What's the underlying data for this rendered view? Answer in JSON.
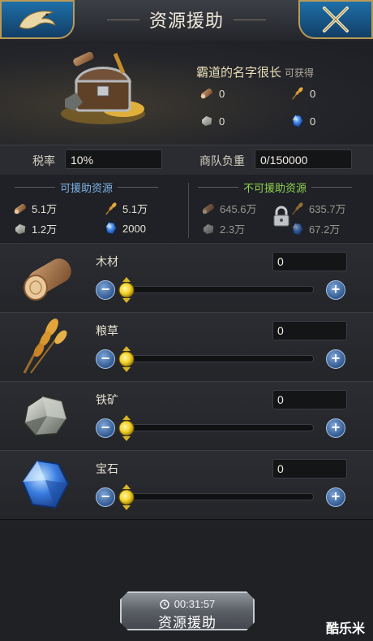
{
  "header": {
    "title": "资源援助",
    "back_icon": "dragon-back-icon",
    "close_icon": "crossed-swords-close-icon"
  },
  "receiver": {
    "name": "霸道的名字很长",
    "suffix": "可获得",
    "gains": [
      {
        "icon": "wood-icon",
        "value": "0"
      },
      {
        "icon": "wheat-icon",
        "value": "0"
      },
      {
        "icon": "iron-ore-icon",
        "value": "0"
      },
      {
        "icon": "gem-icon",
        "value": "0"
      }
    ]
  },
  "tax": {
    "label": "税率",
    "value": "10%"
  },
  "caravan": {
    "label": "商队负重",
    "value": "0/150000"
  },
  "available": {
    "title": "可援助资源",
    "items": [
      {
        "icon": "wood-icon",
        "value": "5.1万"
      },
      {
        "icon": "wheat-icon",
        "value": "5.1万"
      },
      {
        "icon": "iron-ore-icon",
        "value": "1.2万"
      },
      {
        "icon": "gem-icon",
        "value": "2000"
      }
    ]
  },
  "unavailable": {
    "title": "不可援助资源",
    "items": [
      {
        "icon": "wood-icon",
        "value": "645.6万"
      },
      {
        "icon": "wheat-icon",
        "value": "635.7万"
      },
      {
        "icon": "iron-ore-icon",
        "value": "2.3万"
      },
      {
        "icon": "gem-icon",
        "value": "67.2万"
      }
    ]
  },
  "resources": [
    {
      "name": "木材",
      "amount": "0",
      "slider": 0
    },
    {
      "name": "粮草",
      "amount": "0",
      "slider": 0
    },
    {
      "name": "铁矿",
      "amount": "0",
      "slider": 0
    },
    {
      "name": "宝石",
      "amount": "0",
      "slider": 0
    }
  ],
  "action": {
    "timer": "00:31:57",
    "label": "资源援助"
  },
  "watermark": "酷乐米",
  "colors": {
    "accent_blue": "#1e6fa8",
    "available_title": "#7fb2e6",
    "unavailable_title": "#8fd14f",
    "knob_yellow": "#f2d229"
  }
}
